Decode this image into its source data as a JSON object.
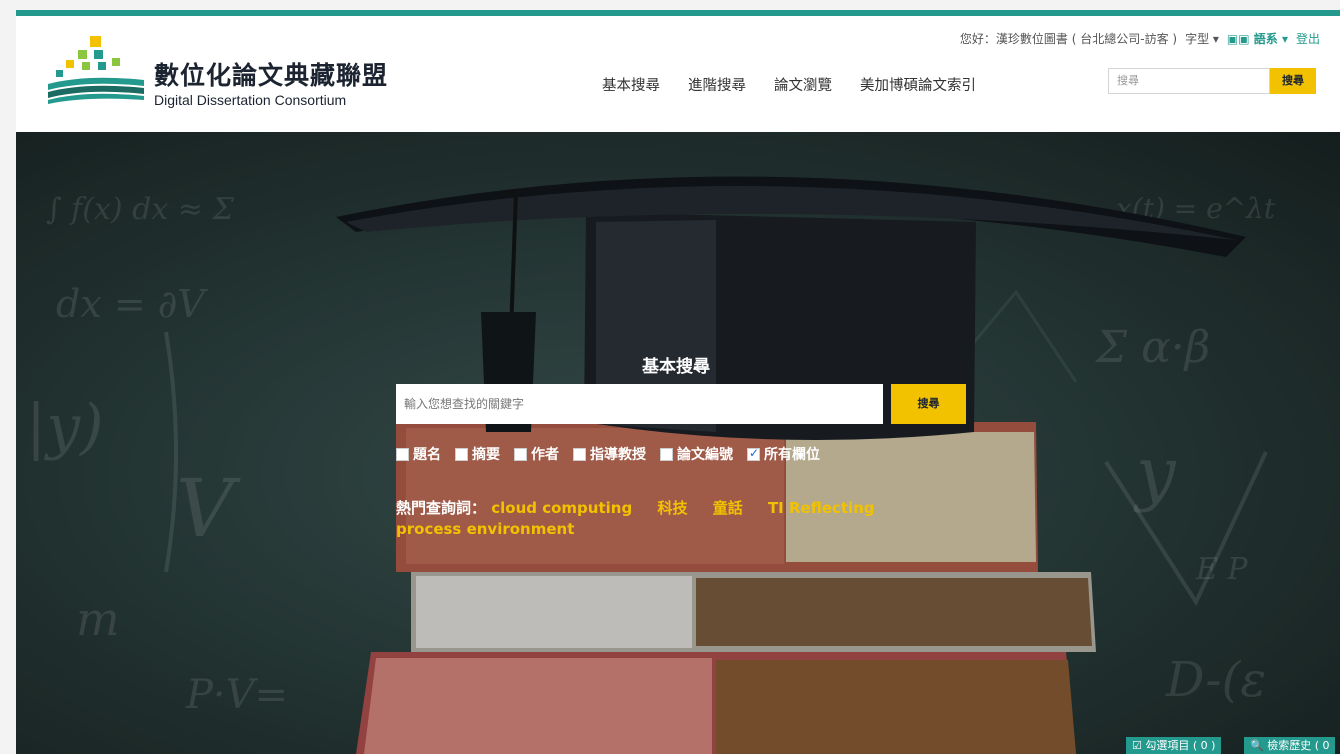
{
  "header": {
    "site_title_zh": "數位化論文典藏聯盟",
    "site_title_en": "Digital Dissertation Consortium",
    "greeting": "您好：漢珍數位圖書 ( 台北總公司-訪客 )",
    "font_size": "字型 ▾",
    "language": "語系 ▾",
    "logout": "登出",
    "nav": [
      "基本搜尋",
      "進階搜尋",
      "論文瀏覽",
      "美加博碩論文索引"
    ],
    "search_placeholder": "搜尋",
    "search_button": "搜尋"
  },
  "hero": {
    "title": "基本搜尋",
    "input_placeholder": "輸入您想查找的關鍵字",
    "search_button": "搜尋",
    "filters": [
      {
        "label": "題名",
        "checked": false
      },
      {
        "label": "摘要",
        "checked": false
      },
      {
        "label": "作者",
        "checked": false
      },
      {
        "label": "指導教授",
        "checked": false
      },
      {
        "label": "論文編號",
        "checked": false
      },
      {
        "label": "所有欄位",
        "checked": true
      }
    ],
    "hot_label": "熱門查詢詞：",
    "hot_terms": [
      "cloud computing",
      "科技",
      "童話",
      "TI Reflecting process environment"
    ]
  },
  "footer_badges": {
    "selected_items": "☑ 勾選項目 ( 0 )",
    "search_history": "🔍 檢索歷史 ( 0"
  },
  "colors": {
    "accent": "#249a8e",
    "button": "#f2c200",
    "hot_term": "#f2c200"
  }
}
